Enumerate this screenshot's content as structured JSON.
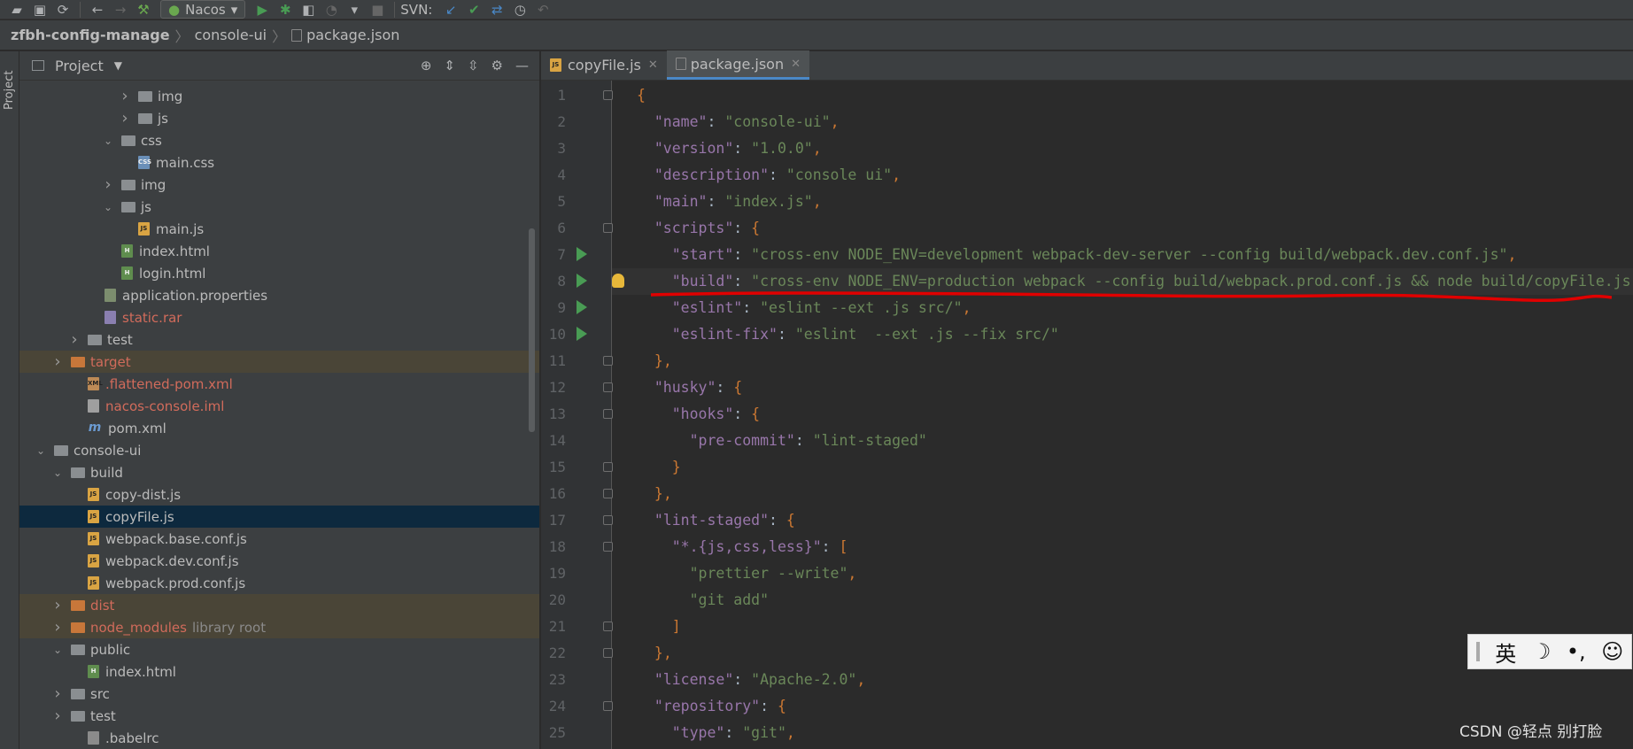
{
  "toolbar": {
    "run_config": "Nacos",
    "svn_label": "SVN:"
  },
  "breadcrumb": [
    "zfbh-config-manage",
    "console-ui",
    "package.json"
  ],
  "side_stripe": {
    "label": "Project"
  },
  "project": {
    "title": "Project",
    "tree": [
      {
        "label": "img",
        "indent": 4,
        "arrow": "right",
        "icon": "folder"
      },
      {
        "label": "js",
        "indent": 4,
        "arrow": "right",
        "icon": "folder"
      },
      {
        "label": "css",
        "indent": 3,
        "arrow": "down",
        "icon": "folder"
      },
      {
        "label": "main.css",
        "indent": 4,
        "icon": "css"
      },
      {
        "label": "img",
        "indent": 3,
        "arrow": "right",
        "icon": "folder"
      },
      {
        "label": "js",
        "indent": 3,
        "arrow": "down",
        "icon": "folder"
      },
      {
        "label": "main.js",
        "indent": 4,
        "icon": "js"
      },
      {
        "label": "index.html",
        "indent": 3,
        "icon": "html"
      },
      {
        "label": "login.html",
        "indent": 3,
        "icon": "html"
      },
      {
        "label": "application.properties",
        "indent": 2,
        "icon": "props"
      },
      {
        "label": "static.rar",
        "indent": 2,
        "icon": "rar",
        "red": true
      },
      {
        "label": "test",
        "indent": 1,
        "arrow": "right",
        "icon": "folder"
      },
      {
        "label": "target",
        "indent": 0,
        "arrow": "right",
        "icon": "folder-orange",
        "red": true,
        "excluded": true
      },
      {
        "label": ".flattened-pom.xml",
        "indent": 1,
        "icon": "xml",
        "red": true
      },
      {
        "label": "nacos-console.iml",
        "indent": 1,
        "icon": "iml",
        "red": true
      },
      {
        "label": "pom.xml",
        "indent": 1,
        "icon": "mvn"
      },
      {
        "label": "console-ui",
        "indent": -1,
        "arrow": "down",
        "icon": "folder"
      },
      {
        "label": "build",
        "indent": 0,
        "arrow": "down",
        "icon": "folder"
      },
      {
        "label": "copy-dist.js",
        "indent": 1,
        "icon": "js"
      },
      {
        "label": "copyFile.js",
        "indent": 1,
        "icon": "js",
        "selected": true
      },
      {
        "label": "webpack.base.conf.js",
        "indent": 1,
        "icon": "js"
      },
      {
        "label": "webpack.dev.conf.js",
        "indent": 1,
        "icon": "js"
      },
      {
        "label": "webpack.prod.conf.js",
        "indent": 1,
        "icon": "js"
      },
      {
        "label": "dist",
        "indent": 0,
        "arrow": "right",
        "icon": "folder-orange",
        "red": true,
        "excluded": true
      },
      {
        "label": "node_modules",
        "indent": 0,
        "arrow": "right",
        "icon": "folder-orange",
        "red": true,
        "excluded": true,
        "suffix": "library root"
      },
      {
        "label": "public",
        "indent": 0,
        "arrow": "down",
        "icon": "folder"
      },
      {
        "label": "index.html",
        "indent": 1,
        "icon": "html"
      },
      {
        "label": "src",
        "indent": 0,
        "arrow": "right",
        "icon": "folder"
      },
      {
        "label": "test",
        "indent": 0,
        "arrow": "right",
        "icon": "folder"
      },
      {
        "label": ".babelrc",
        "indent": 1,
        "icon": "babel"
      }
    ]
  },
  "editor": {
    "tabs": [
      {
        "label": "copyFile.js",
        "active": false
      },
      {
        "label": "package.json",
        "active": true
      }
    ],
    "lines": [
      {
        "n": "1",
        "code": "{",
        "fold": true
      },
      {
        "n": "2",
        "code": "  \"name\": \"console-ui\","
      },
      {
        "n": "3",
        "code": "  \"version\": \"1.0.0\","
      },
      {
        "n": "4",
        "code": "  \"description\": \"console ui\","
      },
      {
        "n": "5",
        "code": "  \"main\": \"index.js\","
      },
      {
        "n": "6",
        "code": "  \"scripts\": {",
        "fold": true
      },
      {
        "n": "7",
        "code": "    \"start\": \"cross-env NODE_ENV=development webpack-dev-server --config build/webpack.dev.conf.js\",",
        "run": true
      },
      {
        "n": "8",
        "code": "    \"build\": \"cross-env NODE_ENV=production webpack --config build/webpack.prod.conf.js && node build/copyFile.js\",",
        "run": true,
        "bulb": true,
        "current": true
      },
      {
        "n": "9",
        "code": "    \"eslint\": \"eslint --ext .js src/\",",
        "run": true
      },
      {
        "n": "10",
        "code": "    \"eslint-fix\": \"eslint  --ext .js --fix src/\"",
        "run": true
      },
      {
        "n": "11",
        "code": "  },",
        "fold": true
      },
      {
        "n": "12",
        "code": "  \"husky\": {",
        "fold": true
      },
      {
        "n": "13",
        "code": "    \"hooks\": {",
        "fold": true
      },
      {
        "n": "14",
        "code": "      \"pre-commit\": \"lint-staged\""
      },
      {
        "n": "15",
        "code": "    }",
        "fold": true
      },
      {
        "n": "16",
        "code": "  },",
        "fold": true
      },
      {
        "n": "17",
        "code": "  \"lint-staged\": {",
        "fold": true
      },
      {
        "n": "18",
        "code": "    \"*.{js,css,less}\": [",
        "fold": true
      },
      {
        "n": "19",
        "code": "      \"prettier --write\","
      },
      {
        "n": "20",
        "code": "      \"git add\""
      },
      {
        "n": "21",
        "code": "    ]",
        "fold": true
      },
      {
        "n": "22",
        "code": "  },",
        "fold": true
      },
      {
        "n": "23",
        "code": "  \"license\": \"Apache-2.0\","
      },
      {
        "n": "24",
        "code": "  \"repository\": {",
        "fold": true
      },
      {
        "n": "25",
        "code": "    \"type\": \"git\","
      }
    ]
  },
  "ime": {
    "items": [
      "英",
      "☽",
      "•,",
      "☺"
    ]
  },
  "watermark": "CSDN @轻点 别打脸",
  "colors": {
    "key": "#9876aa",
    "string": "#6a8759",
    "punct": "#cc7832",
    "annotation": "#e00000"
  }
}
